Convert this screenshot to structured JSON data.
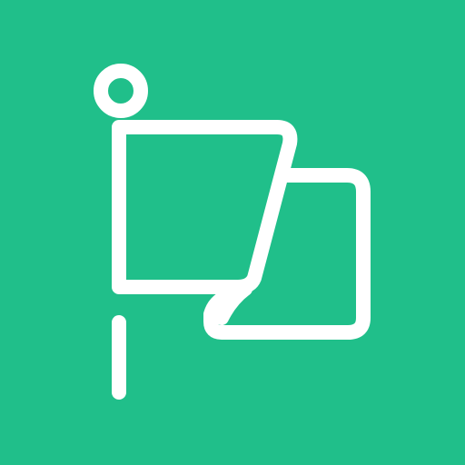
{
  "icon": {
    "name": "flag-icon",
    "background_color": "#20bf8a",
    "stroke_color": "#ffffff"
  }
}
